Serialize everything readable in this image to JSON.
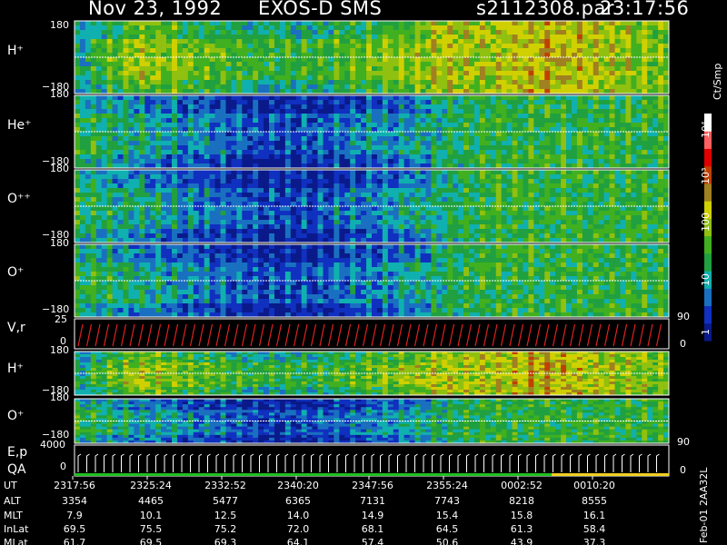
{
  "header": {
    "date": "Nov 23, 1992",
    "mission": "EXOS-D SMS",
    "file": "s2112308.par",
    "time": "23:17:56"
  },
  "colorbar": {
    "unit_label": "Ct/Smp",
    "tick_labels": [
      "10⁴",
      "10³",
      "100",
      "10",
      "1"
    ]
  },
  "panels": [
    {
      "label": "H⁺",
      "top_tick": "180",
      "bottom_tick": "−180"
    },
    {
      "label": "He⁺",
      "top_tick": "180",
      "bottom_tick": "−180"
    },
    {
      "label": "O⁺⁺",
      "top_tick": "180",
      "bottom_tick": "−180"
    },
    {
      "label": "O⁺",
      "top_tick": "180",
      "bottom_tick": "−180"
    },
    {
      "label": "V,r",
      "top_tick": "25",
      "bottom_tick": "0",
      "right_top": "90",
      "right_bottom": "0"
    },
    {
      "label": "H⁺",
      "top_tick": "180",
      "bottom_tick": "−180"
    },
    {
      "label": "O⁺",
      "top_tick": "180",
      "bottom_tick": "−180",
      "right_bottom": "90"
    },
    {
      "label": "E,p",
      "label2": "QA",
      "top_tick": "4000",
      "bottom_tick": "0",
      "right_bottom": "0"
    }
  ],
  "ephemeris": {
    "rows": [
      {
        "name": "UT",
        "values": [
          "2317:56",
          "2325:24",
          "2332:52",
          "2340:20",
          "2347:56",
          "2355:24",
          "0002:52",
          "0010:20"
        ]
      },
      {
        "name": "ALT",
        "values": [
          "3354",
          "4465",
          "5477",
          "6365",
          "7131",
          "7743",
          "8218",
          "8555"
        ]
      },
      {
        "name": "MLT",
        "values": [
          "7.9",
          "10.1",
          "12.5",
          "14.0",
          "14.9",
          "15.4",
          "15.8",
          "16.1"
        ]
      },
      {
        "name": "InLat",
        "values": [
          "69.5",
          "75.5",
          "75.2",
          "72.0",
          "68.1",
          "64.5",
          "61.3",
          "58.4"
        ]
      },
      {
        "name": "MLat",
        "values": [
          "61.7",
          "69.5",
          "69.3",
          "64.1",
          "57.4",
          "50.6",
          "43.9",
          "37.3"
        ]
      }
    ]
  },
  "footer": {
    "stamp": "Feb-01 2AA32L"
  },
  "chart_data": {
    "type": "heatmap",
    "title": "Nov 23, 1992   EXOS-D SMS",
    "x_tick_labels": [
      "2317:56",
      "2325:24",
      "2332:52",
      "2340:20",
      "2347:56",
      "2355:24",
      "0002:52",
      "0010:20"
    ],
    "y_range_deg": [
      -180,
      180
    ],
    "color_scale": "log",
    "color_range": [
      1,
      10000
    ],
    "series": [
      {
        "name": "H⁺",
        "profile": [
          3,
          6,
          5,
          4,
          4,
          5,
          6,
          6,
          7,
          6,
          5
        ]
      },
      {
        "name": "He⁺",
        "profile": [
          4,
          3,
          2,
          1,
          1,
          2,
          3,
          4,
          4,
          4,
          4
        ]
      },
      {
        "name": "O⁺⁺",
        "profile": [
          4,
          3,
          2,
          1,
          1,
          2,
          3,
          4,
          4,
          4,
          4
        ]
      },
      {
        "name": "O⁺",
        "profile": [
          4,
          3,
          2,
          1,
          1,
          2,
          3,
          4,
          4,
          4,
          4
        ]
      }
    ]
  }
}
